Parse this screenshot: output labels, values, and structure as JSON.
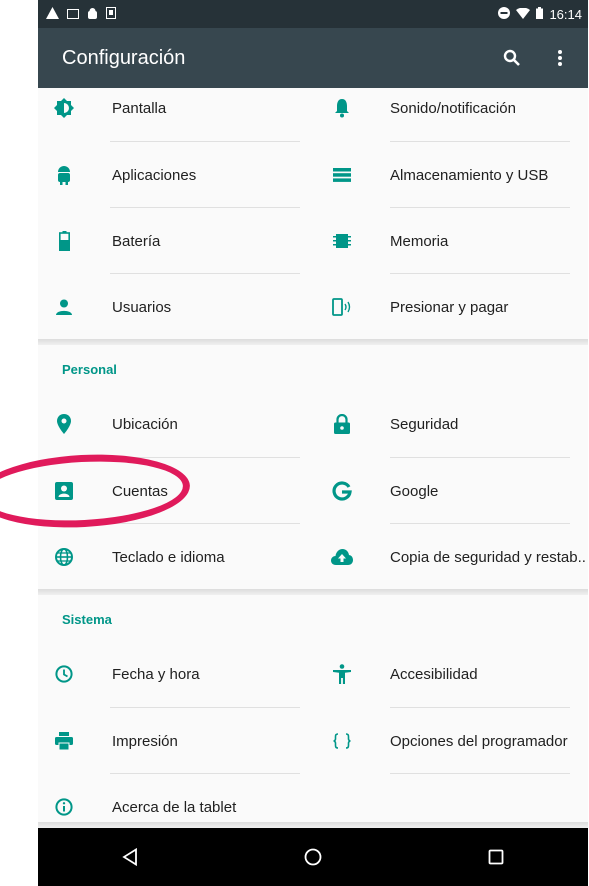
{
  "status_bar": {
    "time": "16:14"
  },
  "app_bar": {
    "title": "Configuración",
    "icons": [
      "search-icon",
      "more-vert-icon"
    ]
  },
  "device_items": [
    {
      "label": "Pantalla",
      "icon": "brightness-icon"
    },
    {
      "label": "Sonido/notificación",
      "icon": "bell-icon"
    },
    {
      "label": "Aplicaciones",
      "icon": "android-icon"
    },
    {
      "label": "Almacenamiento y USB",
      "icon": "storage-icon"
    },
    {
      "label": "Batería",
      "icon": "battery-icon"
    },
    {
      "label": "Memoria",
      "icon": "memory-icon"
    },
    {
      "label": "Usuarios",
      "icon": "person-icon"
    },
    {
      "label": "Presionar y pagar",
      "icon": "tap-pay-icon"
    }
  ],
  "personal": {
    "header": "Personal",
    "items": [
      {
        "label": "Ubicación",
        "icon": "location-icon"
      },
      {
        "label": "Seguridad",
        "icon": "lock-icon"
      },
      {
        "label": "Cuentas",
        "icon": "account-box-icon"
      },
      {
        "label": "Google",
        "icon": "google-icon"
      },
      {
        "label": "Teclado e idioma",
        "icon": "globe-icon"
      },
      {
        "label": "Copia de seguridad y restab..",
        "icon": "cloud-upload-icon"
      }
    ]
  },
  "sistema": {
    "header": "Sistema",
    "items": [
      {
        "label": "Fecha y hora",
        "icon": "clock-icon"
      },
      {
        "label": "Accesibilidad",
        "icon": "accessibility-icon"
      },
      {
        "label": "Impresión",
        "icon": "print-icon"
      },
      {
        "label": "Opciones del programador",
        "icon": "code-braces-icon"
      },
      {
        "label": "Acerca de la tablet",
        "icon": "info-icon"
      }
    ]
  },
  "colors": {
    "accent": "#009688",
    "appbar": "#37474f",
    "statusbar": "#263238",
    "highlight": "#e01a5b"
  }
}
